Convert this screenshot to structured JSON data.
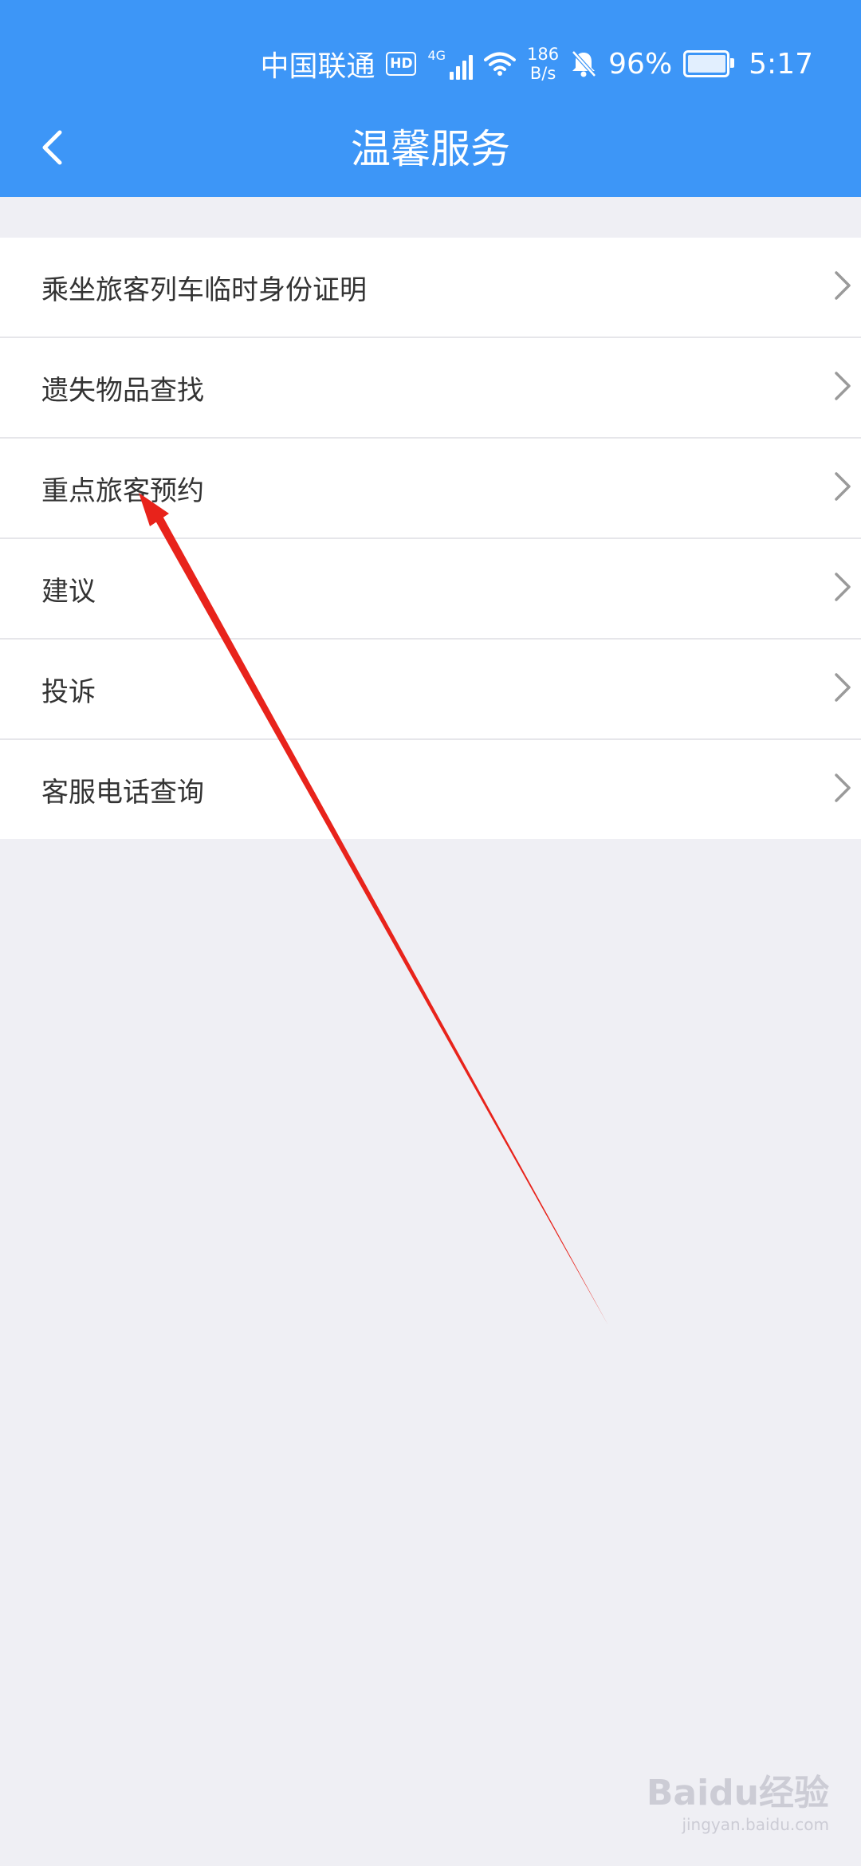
{
  "status_bar": {
    "carrier": "中国联通",
    "hd": "HD",
    "network": "4G",
    "speed_value": "186",
    "speed_unit": "B/s",
    "battery": "96%",
    "time": "5:17"
  },
  "header": {
    "title": "温馨服务",
    "back_icon": "chevron-left-icon"
  },
  "menu": {
    "items": [
      {
        "label": "乘坐旅客列车临时身份证明"
      },
      {
        "label": "遗失物品查找"
      },
      {
        "label": "重点旅客预约"
      },
      {
        "label": "建议"
      },
      {
        "label": "投诉"
      },
      {
        "label": "客服电话查询"
      }
    ]
  },
  "watermark": {
    "brand": "Baidu经验",
    "url": "jingyan.baidu.com"
  },
  "colors": {
    "header_bg": "#3d96f7",
    "page_bg": "#efeff4",
    "annotation": "#e8231b"
  }
}
